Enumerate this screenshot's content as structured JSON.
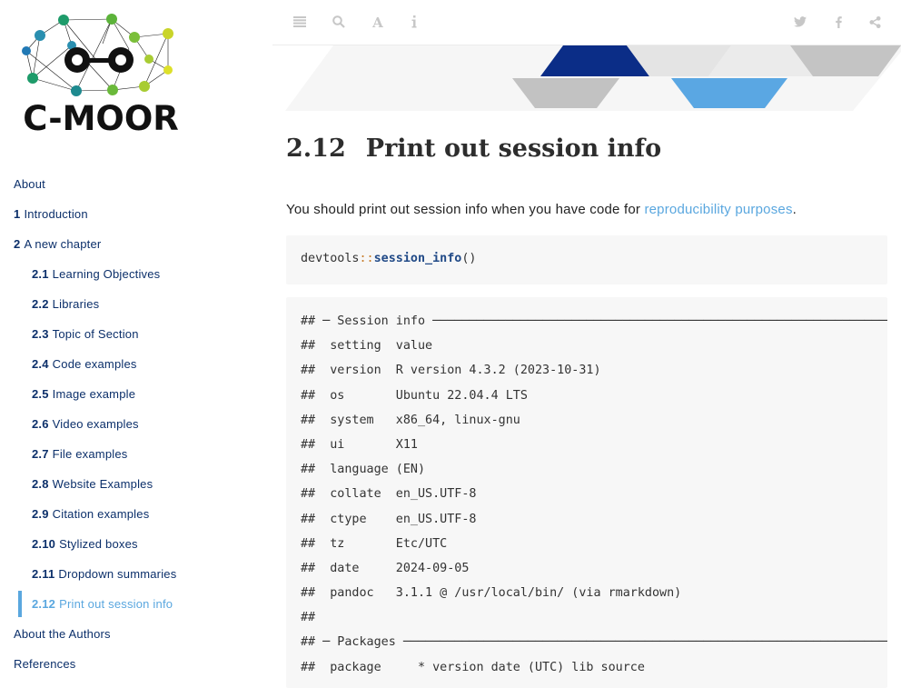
{
  "brand": {
    "logo_text": "C-MOOR"
  },
  "toolbar": {
    "left_icons": [
      "hamburger-icon",
      "search-icon",
      "font-icon",
      "info-icon"
    ],
    "right_icons": [
      "twitter-icon",
      "facebook-icon",
      "share-icon"
    ],
    "icon_color": "#c7c7c7"
  },
  "toc": {
    "items": [
      {
        "num": "",
        "label": "About"
      },
      {
        "num": "1",
        "label": "Introduction"
      },
      {
        "num": "2",
        "label": "A new chapter"
      },
      {
        "num": "2.1",
        "label": "Learning Objectives"
      },
      {
        "num": "2.2",
        "label": "Libraries"
      },
      {
        "num": "2.3",
        "label": "Topic of Section"
      },
      {
        "num": "2.4",
        "label": "Code examples"
      },
      {
        "num": "2.5",
        "label": "Image example"
      },
      {
        "num": "2.6",
        "label": "Video examples"
      },
      {
        "num": "2.7",
        "label": "File examples"
      },
      {
        "num": "2.8",
        "label": "Website Examples"
      },
      {
        "num": "2.9",
        "label": "Citation examples"
      },
      {
        "num": "2.10",
        "label": "Stylized boxes"
      },
      {
        "num": "2.11",
        "label": "Dropdown summaries"
      },
      {
        "num": "2.12",
        "label": "Print out session info"
      },
      {
        "num": "",
        "label": "About the Authors"
      },
      {
        "num": "",
        "label": "References"
      }
    ],
    "active": "2.12",
    "link_color": "#0b2f6a",
    "active_color": "#5aa7df"
  },
  "page": {
    "section_num": "2.12",
    "section_title": "Print out session info",
    "intro_text": "You should print out session info when you have code for ",
    "intro_link": "reproducibility purposes",
    "intro_end": "."
  },
  "code": {
    "namespace": "devtools",
    "operator": "::",
    "function": "session_info",
    "args": "()"
  },
  "output": {
    "lines": [
      "## ─ Session info ───────────────────────────────────────────────────────────────",
      "##  setting  value",
      "##  version  R version 4.3.2 (2023-10-31)",
      "##  os       Ubuntu 22.04.4 LTS",
      "##  system   x86_64, linux-gnu",
      "##  ui       X11",
      "##  language (EN)",
      "##  collate  en_US.UTF-8",
      "##  ctype    en_US.UTF-8",
      "##  tz       Etc/UTC",
      "##  date     2024-09-05",
      "##  pandoc   3.1.1 @ /usr/local/bin/ (via rmarkdown)",
      "##",
      "## ─ Packages ───────────────────────────────────────────────────────────────────",
      "##  package     * version date (UTC) lib source"
    ]
  }
}
